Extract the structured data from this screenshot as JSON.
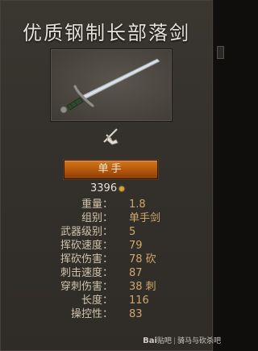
{
  "item": {
    "title": "优质钢制长部落剑",
    "handedness_label": "单手",
    "price": "3396"
  },
  "icons": {
    "weapon_image": "sword-thumbnail",
    "weapon_type_icon": "one-handed-sword-icon",
    "coin_icon": "gold-coin-icon"
  },
  "stats": [
    {
      "label": "重量：",
      "value": "1.8"
    },
    {
      "label": "组别：",
      "value": "单手剑"
    },
    {
      "label": "武器级别：",
      "value": "5"
    },
    {
      "label": "挥砍速度：",
      "value": "79"
    },
    {
      "label": "挥砍伤害：",
      "value": "78  砍"
    },
    {
      "label": "刺击速度：",
      "value": "87"
    },
    {
      "label": "穿刺伤害：",
      "value": "38  刺"
    },
    {
      "label": "长度：",
      "value": "116"
    },
    {
      "label": "操控性：",
      "value": "83"
    }
  ],
  "watermark": {
    "brand": "Bai",
    "brand_suffix": "贴吧",
    "forum": "骑马与砍杀吧"
  },
  "colors": {
    "panel_bg": "#34312c",
    "accent_orange": "#c8650f",
    "value_gold": "#cfa86a",
    "label_beige": "#cfc3ad"
  }
}
